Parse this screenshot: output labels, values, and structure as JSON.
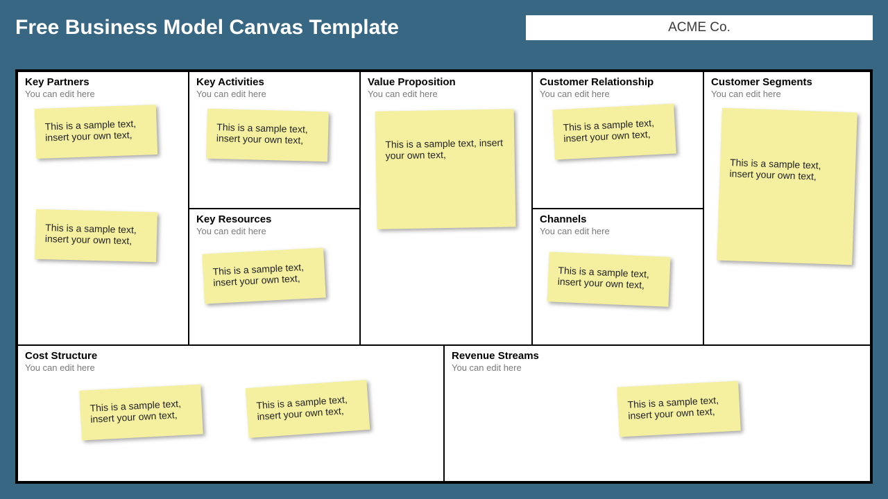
{
  "title": "Free Business Model Canvas Template",
  "company": "ACME Co.",
  "edit_hint": "You can edit here",
  "note_text": "This is a sample text, insert your own text,",
  "sections": {
    "key_partners": {
      "title": "Key Partners"
    },
    "key_activities": {
      "title": "Key Activities"
    },
    "key_resources": {
      "title": "Key Resources"
    },
    "value_prop": {
      "title": "Value Proposition"
    },
    "cust_rel": {
      "title": "Customer Relationship"
    },
    "channels": {
      "title": "Channels"
    },
    "cust_seg": {
      "title": "Customer Segments"
    },
    "cost": {
      "title": "Cost Structure"
    },
    "revenue": {
      "title": "Revenue Streams"
    }
  }
}
